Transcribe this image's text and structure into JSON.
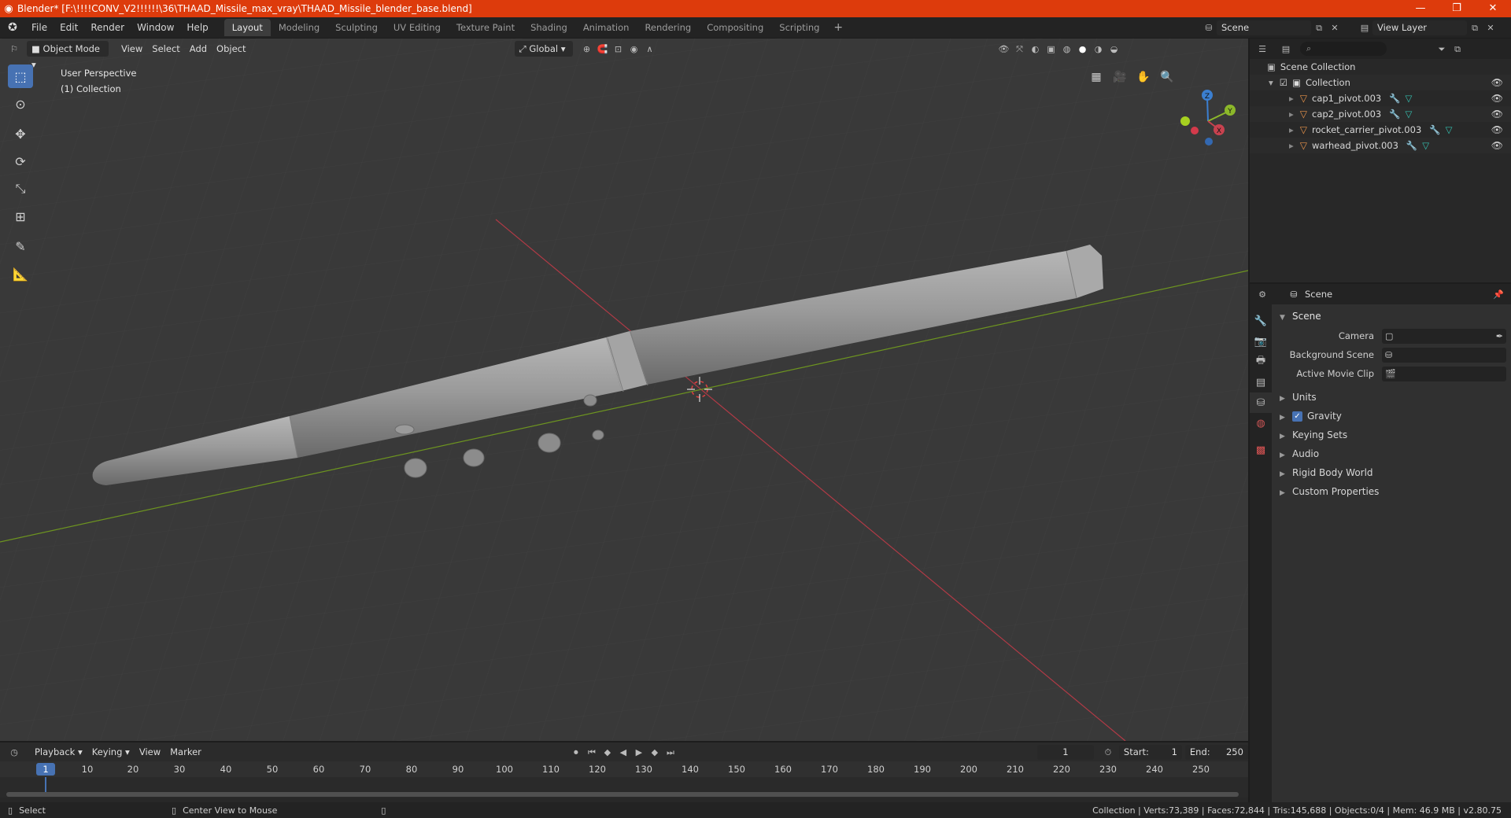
{
  "window": {
    "title": "Blender* [F:\\!!!!CONV_V2!!!!!!\\36\\THAAD_Missile_max_vray\\THAAD_Missile_blender_base.blend]",
    "minimize": "—",
    "maximize": "❐",
    "close": "✕"
  },
  "menu": [
    "File",
    "Edit",
    "Render",
    "Window",
    "Help"
  ],
  "workspaces": [
    "Layout",
    "Modeling",
    "Sculpting",
    "UV Editing",
    "Texture Paint",
    "Shading",
    "Animation",
    "Rendering",
    "Compositing",
    "Scripting"
  ],
  "active_workspace": "Layout",
  "scene_selector": "Scene",
  "view_layer_selector": "View Layer",
  "viewport": {
    "mode": "Object Mode",
    "menus": [
      "View",
      "Select",
      "Add",
      "Object"
    ],
    "transform_orientation": "Global",
    "perspective_label": "User Perspective",
    "collection_label": "(1) Collection",
    "gizmo": {
      "x": "X",
      "y": "Y",
      "z": "Z"
    }
  },
  "outliner": {
    "root": "Scene Collection",
    "collection": "Collection",
    "objects": [
      "cap1_pivot.003",
      "cap2_pivot.003",
      "rocket_carrier_pivot.003",
      "warhead_pivot.003"
    ]
  },
  "properties": {
    "context": "Scene",
    "panel": "Scene",
    "camera_label": "Camera",
    "background_scene_label": "Background Scene",
    "movie_clip_label": "Active Movie Clip",
    "subpanels": [
      "Units",
      "Gravity",
      "Keying Sets",
      "Audio",
      "Rigid Body World",
      "Custom Properties"
    ],
    "gravity_enabled": true
  },
  "timeline": {
    "menus": [
      "Playback",
      "Keying",
      "View",
      "Marker"
    ],
    "current_frame": "1",
    "start_label": "Start:",
    "start": "1",
    "end_label": "End:",
    "end": "250",
    "ruler_labels": [
      "1",
      "10",
      "20",
      "30",
      "40",
      "50",
      "60",
      "70",
      "80",
      "90",
      "100",
      "110",
      "120",
      "130",
      "140",
      "150",
      "160",
      "170",
      "180",
      "190",
      "200",
      "210",
      "220",
      "230",
      "240",
      "250"
    ]
  },
  "statusbar": {
    "left_action": "Select",
    "middle_action": "Center View to Mouse",
    "stats": "Collection | Verts:73,389 | Faces:72,844 | Tris:145,688 | Objects:0/4 | Mem: 46.9 MB | v2.80.75"
  },
  "colors": {
    "accent": "#4772b3",
    "titlebar": "#dd3b0c",
    "x_axis": "#c8424f",
    "y_axis": "#8cb82a",
    "z_axis": "#3b7fd0"
  }
}
